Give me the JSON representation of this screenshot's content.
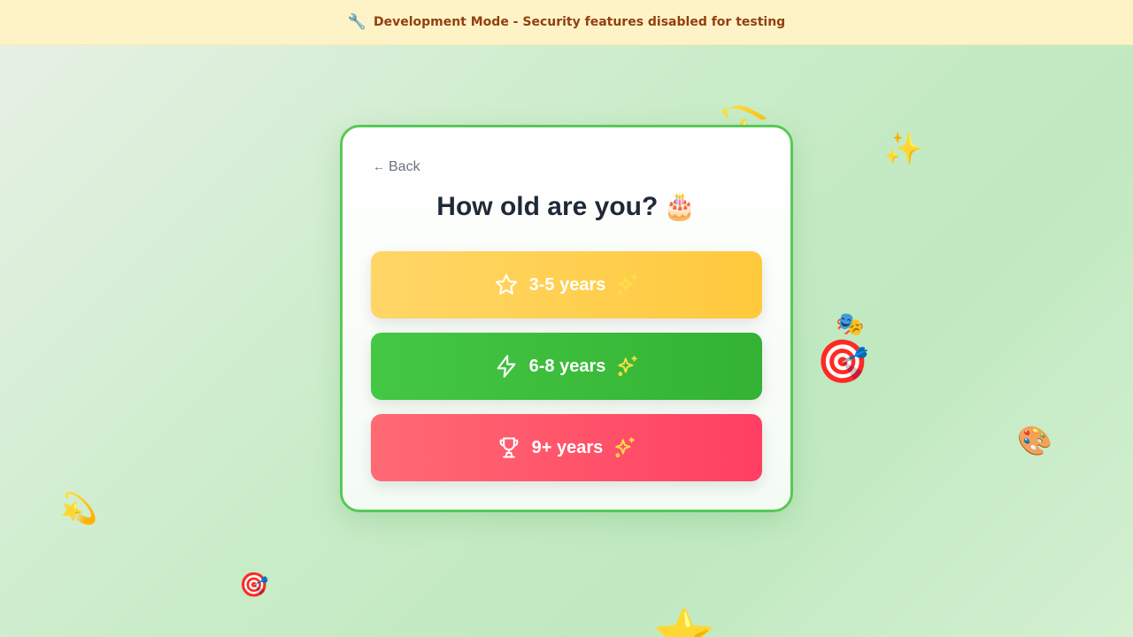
{
  "banner": {
    "icon": "wrench-icon",
    "glyph": "🔧",
    "text": "Development Mode - Security features disabled for testing"
  },
  "decorations": {
    "ring_glyph": "💫",
    "sparkles_glyph": "✨",
    "theater_glyph": "🎭",
    "target_glyph": "🎯",
    "palette_glyph": "🎨",
    "star_glyph": "⭐"
  },
  "card": {
    "back_arrow": "←",
    "back_label": "Back",
    "title": "How old are you?",
    "title_emoji": "🎂",
    "options": [
      {
        "label": "3-5 years",
        "icon": "star-icon",
        "color": "#ffcf4f"
      },
      {
        "label": "6-8 years",
        "icon": "lightning-icon",
        "color": "#3cbf3c"
      },
      {
        "label": "9+ years",
        "icon": "trophy-icon",
        "color": "#ff5068"
      }
    ],
    "sparkle_color": "#fde047",
    "border_color": "#57c957"
  }
}
